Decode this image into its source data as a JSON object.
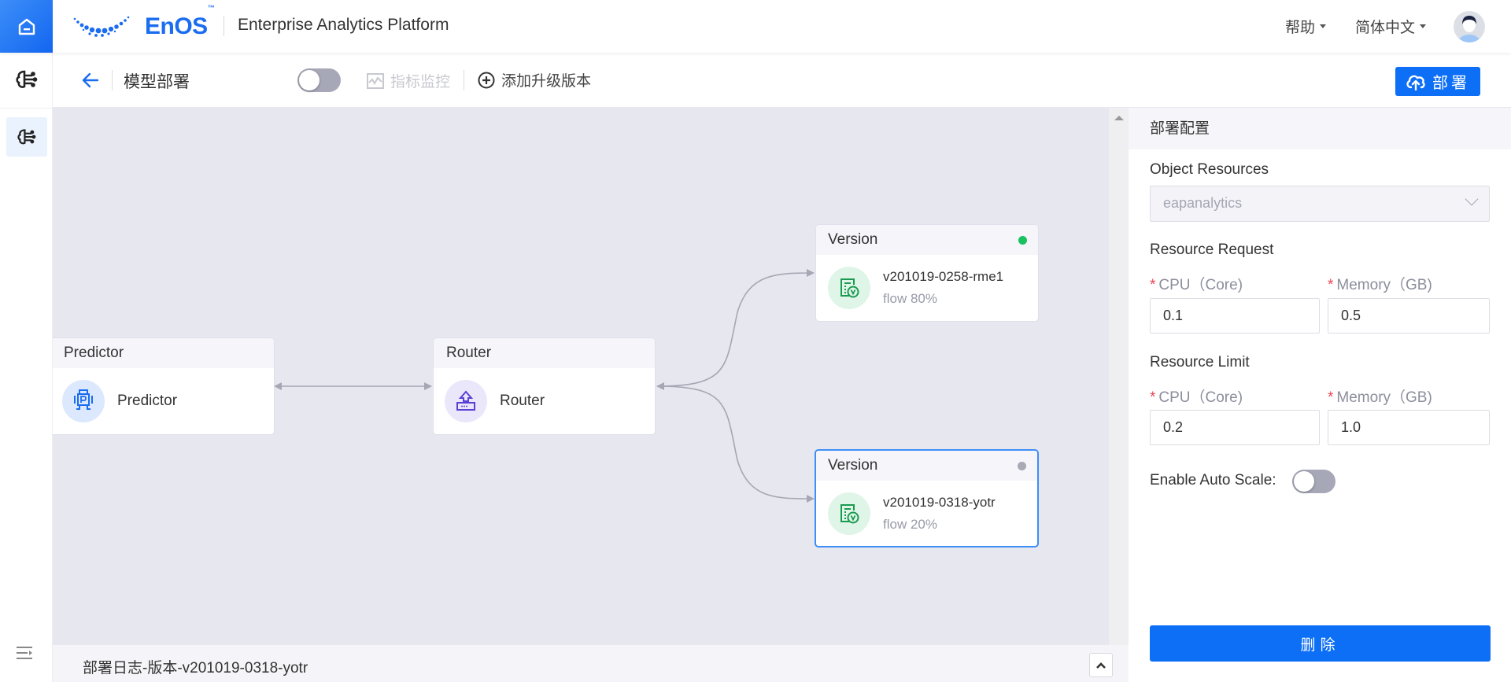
{
  "header": {
    "brand": "EnOS",
    "brand_tm": "™",
    "app_title": "Enterprise Analytics Platform",
    "help_menu": "帮助",
    "language_menu": "简体中文"
  },
  "toolbar": {
    "page_title": "模型部署",
    "monitor_label": "指标监控",
    "add_version_label": "添加升级版本",
    "deploy_label": "部署",
    "mode_toggle_on": false
  },
  "canvas": {
    "nodes": [
      {
        "type": "Predictor",
        "header": "Predictor",
        "label": "Predictor"
      },
      {
        "type": "Router",
        "header": "Router",
        "label": "Router"
      },
      {
        "type": "Version",
        "header": "Version",
        "name": "v201019-0258-rme1",
        "flow": "flow 80%",
        "status": "running",
        "status_color": "#19c161"
      },
      {
        "type": "Version",
        "header": "Version",
        "name": "v201019-0318-yotr",
        "flow": "flow 20%",
        "status": "inactive",
        "status_color": "#a8a9b3",
        "selected": true
      }
    ],
    "edges": [
      {
        "from": "Predictor",
        "to": "Router",
        "bidirectional": true
      },
      {
        "from": "Router",
        "to": "v201019-0258-rme1"
      },
      {
        "from": "Router",
        "to": "v201019-0318-yotr"
      }
    ]
  },
  "log_bar": {
    "title": "部署日志-版本-v201019-0318-yotr"
  },
  "panel": {
    "title": "部署配置",
    "object_resources_label": "Object Resources",
    "object_resources_value": "eapanalytics",
    "resource_request_label": "Resource Request",
    "resource_limit_label": "Resource Limit",
    "cpu_label": "CPU（Core)",
    "memory_label": "Memory（GB)",
    "required_mark": "*",
    "request_cpu": "0.1",
    "request_memory": "0.5",
    "limit_cpu": "0.2",
    "limit_memory": "1.0",
    "auto_scale_label": "Enable Auto Scale:",
    "auto_scale_on": false,
    "delete_label": "删除"
  },
  "colors": {
    "accent": "#0d6ff5",
    "canvas_bg": "#e7e7f0",
    "status_running": "#19c161",
    "status_inactive": "#a8a9b3",
    "required": "#f04354"
  }
}
